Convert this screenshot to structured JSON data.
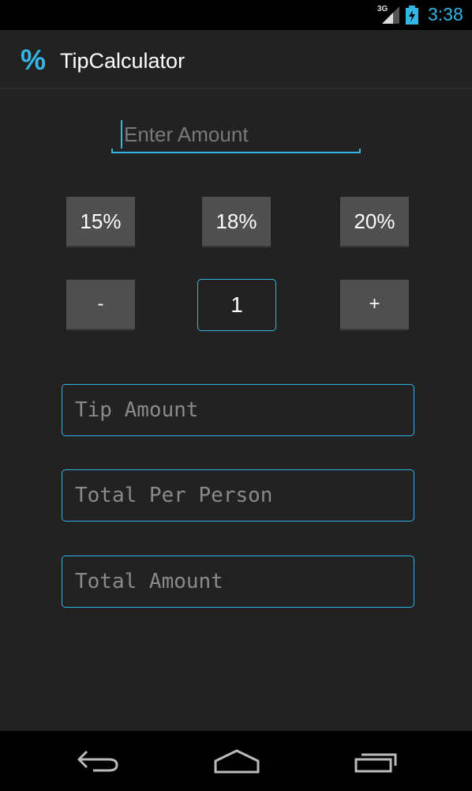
{
  "status_bar": {
    "network": "3G",
    "time": "3:38",
    "icons": [
      "signal-icon",
      "battery-charging-icon"
    ]
  },
  "action_bar": {
    "icon_glyph": "%",
    "title": "TipCalculator"
  },
  "amount_input": {
    "value": "",
    "placeholder": "Enter Amount"
  },
  "tip_buttons": [
    {
      "label": "15%"
    },
    {
      "label": "18%"
    },
    {
      "label": "20%"
    }
  ],
  "people": {
    "decrement_label": "-",
    "count": "1",
    "increment_label": "+"
  },
  "results": {
    "tip_amount": "Tip Amount",
    "total_per_person": "Total Per Person",
    "total_amount": "Total Amount"
  },
  "nav_bar": {
    "icons": [
      "back-icon",
      "home-icon",
      "recent-apps-icon"
    ]
  },
  "colors": {
    "accent": "#33b5e5",
    "background": "#222222",
    "button": "#4f4f4f"
  }
}
